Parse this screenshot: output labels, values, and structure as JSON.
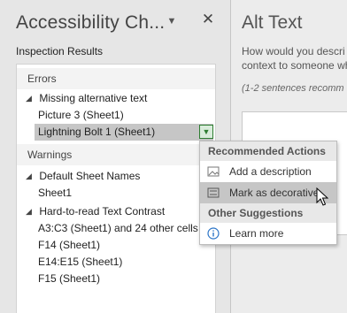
{
  "left_pane": {
    "title": "Accessibility Ch...",
    "section_label": "Inspection Results",
    "groups": [
      {
        "header": "Errors",
        "items": [
          {
            "label": "Missing alternative text",
            "expandable": true
          },
          {
            "label": "Picture 3 (Sheet1)"
          },
          {
            "label": "Lightning Bolt 1 (Sheet1)",
            "selected": true
          }
        ]
      },
      {
        "header": "Warnings",
        "items": [
          {
            "label": "Default Sheet Names",
            "expandable": true
          },
          {
            "label": "Sheet1"
          },
          {
            "label": "Hard-to-read Text Contrast",
            "expandable": true
          },
          {
            "label": "A3:C3 (Sheet1) and 24 other cells"
          },
          {
            "label": "F14 (Sheet1)"
          },
          {
            "label": "E14:E15 (Sheet1)"
          },
          {
            "label": "F15 (Sheet1)"
          }
        ]
      }
    ]
  },
  "right_pane": {
    "title": "Alt Text",
    "line1": "How would you descri",
    "line2": "context to someone wh",
    "hint": "(1-2 sentences recomm"
  },
  "popup": {
    "recommended_header": "Recommended Actions",
    "add_description": "Add a description",
    "mark_decorative": "Mark as decorative",
    "other_header": "Other Suggestions",
    "learn_more": "Learn more"
  },
  "colors": {
    "selection": "#c6c6c6",
    "dropdown_accent": "#2e7d32",
    "info_icon": "#2b74c7"
  }
}
